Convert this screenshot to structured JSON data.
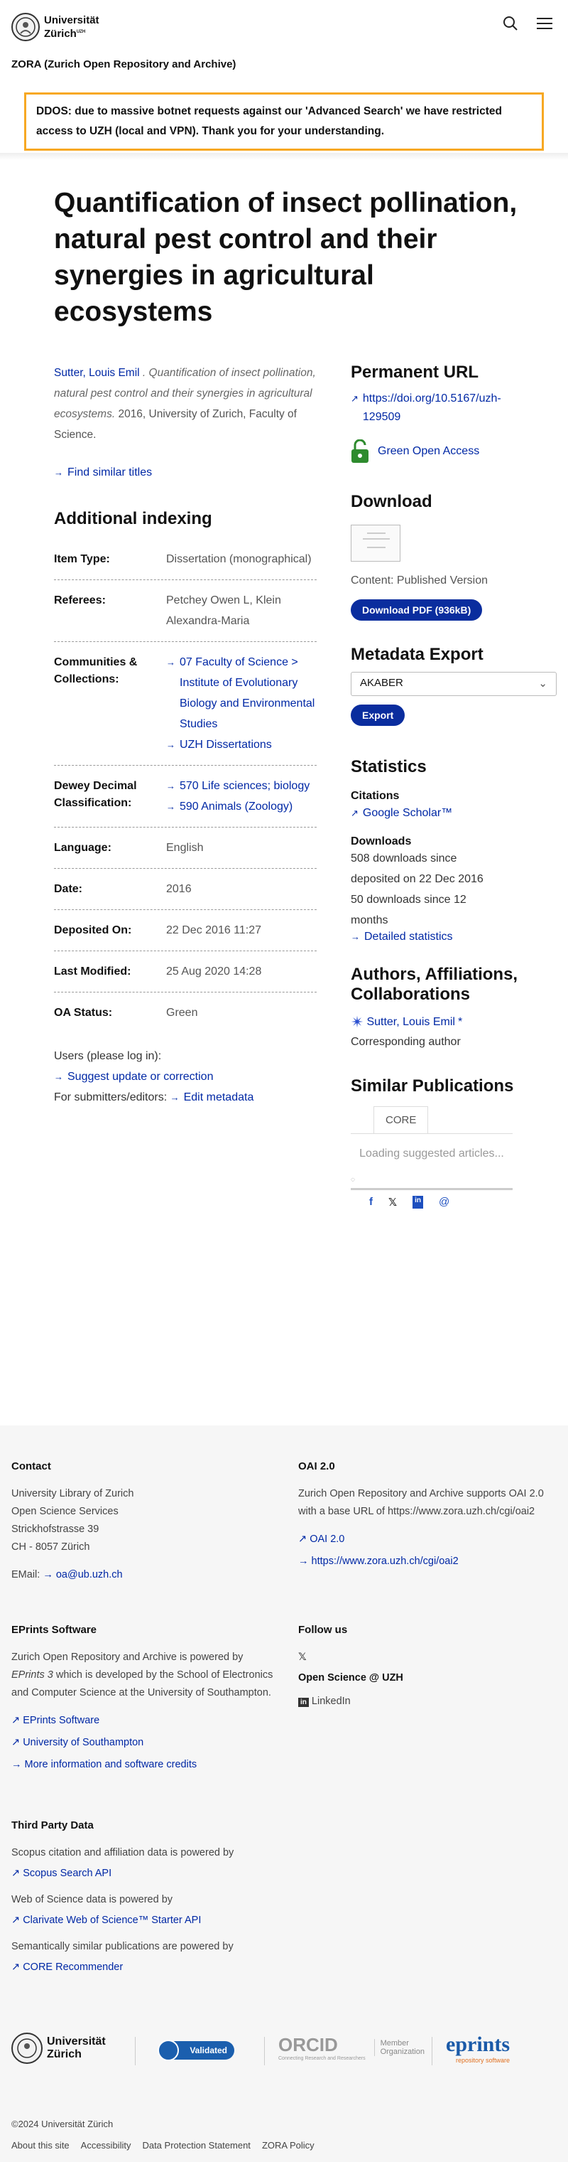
{
  "header": {
    "uni_line1": "Universität",
    "uni_line2": "Zürich",
    "uzh_sup": "UZH",
    "repo_title": "ZORA (Zurich Open Repository and Archive)",
    "search_label": "search-icon",
    "menu_label": "menu-icon"
  },
  "notice": {
    "text": "DDOS: due to massive botnet requests against our 'Advanced Search' we have restricted access to UZH (local and VPN). Thank you for your understanding."
  },
  "title": "Quantification of insect pollination, natural pest control and their synergies in agricultural ecosystems",
  "citation": {
    "author": "Sutter, Louis Emil",
    "title_it": ". Quantification of insect pollination, natural pest control and their synergies in agricultural ecosystems.",
    "rest": " 2016, University of Zurich, Faculty of Science."
  },
  "find_similar": "Find similar titles",
  "additional_indexing": {
    "heading": "Additional indexing",
    "item_type": {
      "label": "Item Type:",
      "value": "Dissertation (monographical)"
    },
    "referees": {
      "label": "Referees:",
      "value": "Petchey Owen L, Klein Alexandra-Maria"
    },
    "communities": {
      "label": "Communities & Collections:",
      "links": [
        "07 Faculty of Science > Institute of Evolutionary Biology and Environmental Studies",
        "UZH Dissertations"
      ]
    },
    "dewey": {
      "label": "Dewey Decimal Classification:",
      "links": [
        "570 Life sciences; biology",
        "590 Animals (Zoology)"
      ]
    },
    "language": {
      "label": "Language:",
      "value": "English"
    },
    "date": {
      "label": "Date:",
      "value": "2016"
    },
    "deposited": {
      "label": "Deposited On:",
      "value": "22 Dec 2016 11:27"
    },
    "modified": {
      "label": "Last Modified:",
      "value": "25 Aug 2020 14:28"
    },
    "oa_status": {
      "label": "OA Status:",
      "value": "Green"
    }
  },
  "users": {
    "label": "Users (please log in):",
    "link": "Suggest update or correction"
  },
  "submitters": {
    "label": "For submitters/editors:",
    "link": "Edit metadata"
  },
  "permanent": {
    "heading": "Permanent URL",
    "doi": "https://doi.org/10.5167/uzh-129509",
    "oa": "Green Open Access"
  },
  "download": {
    "heading": "Download",
    "content": "Content: Published Version",
    "button": "Download PDF (936kB)"
  },
  "metadata_export": {
    "heading": "Metadata Export",
    "selected": "AKABER",
    "button": "Export"
  },
  "statistics": {
    "heading": "Statistics",
    "citations": "Citations",
    "scholar": "Google Scholar™",
    "downloads": "Downloads",
    "line1": "508 downloads since deposited on 22 Dec 2016",
    "line2": "50 downloads since 12 months",
    "detailed": "Detailed statistics"
  },
  "authors": {
    "heading": "Authors, Affiliations, Collaborations",
    "name": "Sutter, Louis Emil",
    "star": "*",
    "role": "Corresponding author"
  },
  "similar": {
    "heading": "Similar Publications",
    "tab": "CORE",
    "loading": "Loading suggested articles..."
  },
  "footer": {
    "contact": {
      "heading": "Contact",
      "lines": [
        "University Library of Zurich",
        "Open Science Services",
        "Strickhofstrasse 39",
        "CH - 8057 Zürich"
      ],
      "email_label": "EMail:",
      "email": "oa@ub.uzh.ch"
    },
    "oai": {
      "heading": "OAI 2.0",
      "text": "Zurich Open Repository and Archive supports OAI 2.0 with a base URL of https://www.zora.uzh.ch/cgi/oai2",
      "link1": "OAI 2.0",
      "link2": "https://www.zora.uzh.ch/cgi/oai2"
    },
    "eprints": {
      "heading": "EPrints Software",
      "text1": "Zurich Open Repository and Archive is powered by ",
      "text_it": "EPrints 3",
      "text2": " which is developed by the School of Electronics and Computer Science at the University of Southampton.",
      "links": [
        "EPrints Software",
        "University of Southampton",
        "More information and software credits"
      ]
    },
    "follow": {
      "heading": "Follow us",
      "osh": "Open Science @ UZH",
      "linkedin": "LinkedIn"
    },
    "third": {
      "heading": "Third Party Data",
      "scopus_text": "Scopus citation and affiliation data is powered by",
      "scopus_link": "Scopus Search API",
      "wos_text": "Web of Science data is powered by",
      "wos_link": "Clarivate Web of Science™ Starter API",
      "core_text": "Semantically similar publications are powered by",
      "core_link": "CORE Recommender"
    },
    "logos": {
      "validated": "Validated",
      "orcid": "ORCID",
      "orcid_sub": "Connecting Research and Researchers",
      "member": "Member Organization",
      "eprints": "eprints",
      "eprints_sub": "repository software"
    },
    "copyright": "©2024 Universität Zürich",
    "links": [
      "About this site",
      "Accessibility",
      "Data Protection Statement",
      "ZORA Policy"
    ]
  }
}
